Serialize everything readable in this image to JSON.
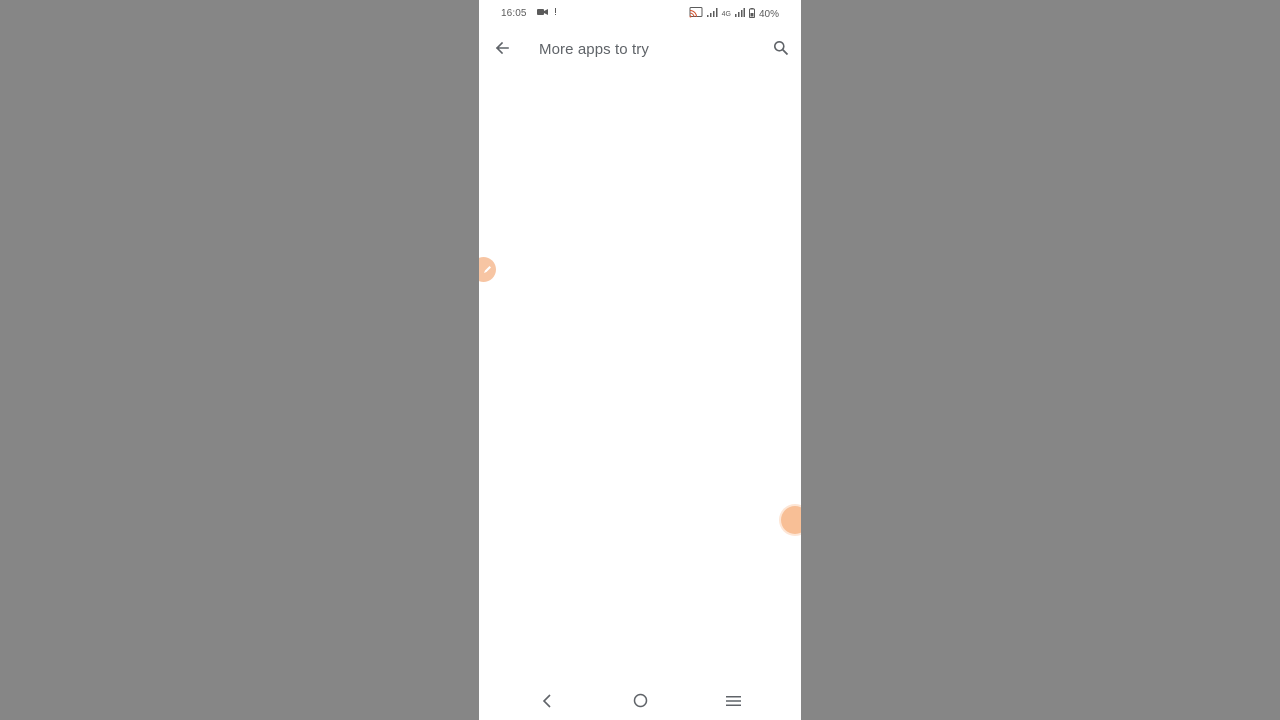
{
  "status_bar": {
    "time": "16:05",
    "network": "4G",
    "battery": "40%",
    "icons": [
      "video-camera-icon",
      "alert-icon",
      "cast-icon",
      "signal-icon",
      "signal-icon",
      "battery-icon"
    ]
  },
  "app_bar": {
    "title": "More apps to try",
    "back_icon": "arrow-back-icon",
    "search_icon": "search-icon"
  },
  "nav_bar": {
    "icons": [
      "nav-back-icon",
      "nav-home-icon",
      "nav-menu-icon"
    ]
  },
  "colors": {
    "backdrop": "#868686",
    "screen": "#ffffff",
    "text": "#5f6368",
    "bubble": "#f8bf96"
  }
}
